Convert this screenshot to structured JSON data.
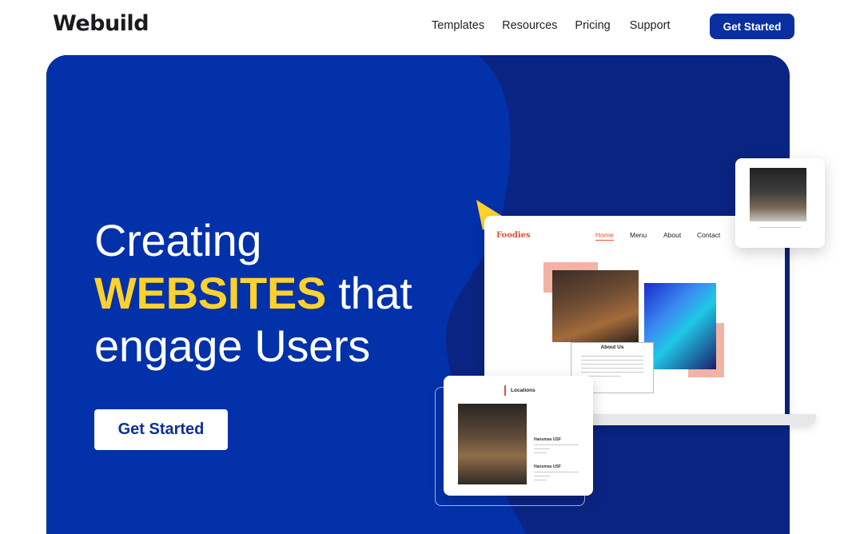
{
  "header": {
    "logo": "Webuild",
    "nav": [
      "Templates",
      "Resources",
      "Pricing",
      "Support"
    ],
    "cta": "Get Started"
  },
  "hero": {
    "line1": "Creating",
    "highlight": "WEBSITES",
    "line2_rest": " that",
    "line3": "engage Users",
    "cta": "Get Started"
  },
  "mockup": {
    "brand": "Foodies",
    "nav": [
      "Home",
      "Menu",
      "About",
      "Contact"
    ],
    "about_title": "About Us",
    "locations_title": "Locations",
    "loc_name_1": "Hanumas USF",
    "loc_name_2": "Hanumas USF"
  },
  "colors": {
    "brand_blue": "#0a2fa0",
    "hero_blue": "#0231aa",
    "hero_dark": "#0a2483",
    "highlight_yellow": "#ffd22b",
    "accent_orange": "#e0503a",
    "peach": "#f3b3a4"
  }
}
